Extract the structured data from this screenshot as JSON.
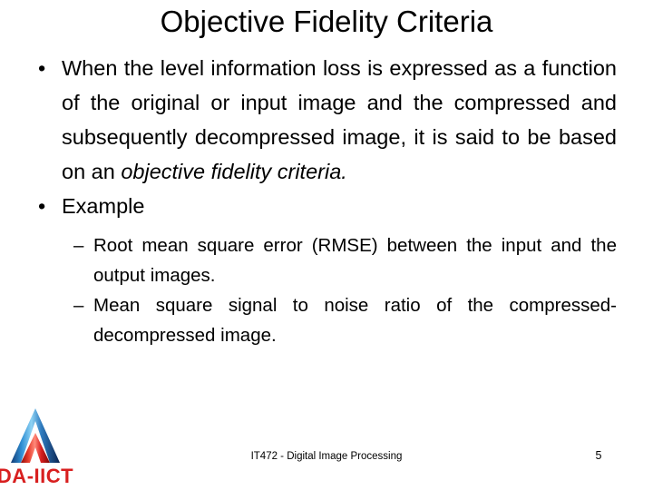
{
  "slide": {
    "title": "Objective Fidelity Criteria",
    "background_color": "#ffffff",
    "text_color": "#000000"
  },
  "content": {
    "bullet_marker": "•",
    "sub_bullet_marker": "–",
    "bullets": [
      {
        "level": 1,
        "text_plain": "When the level information loss is expressed as a function of the original or input image and the compressed and subsequently decompressed image, it is said to be based on an objective fidelity criteria.",
        "text_before_italic": "When the level information loss is expressed as a function of the original or input image and the compressed and subsequently decompressed image, it is said to be based on an ",
        "italic_text": "objective fidelity criteria."
      },
      {
        "level": 1,
        "text_plain": "Example"
      }
    ],
    "sub_bullets": [
      {
        "level": 2,
        "text_plain": "Root mean square error (RMSE) between the input and the output images."
      },
      {
        "level": 2,
        "text_plain": "Mean square signal to noise ratio of the compressed-decompressed image."
      }
    ]
  },
  "footer": {
    "course": "IT472 - Digital Image Processing",
    "page_number": "5"
  },
  "logo": {
    "text": "DA-IICT",
    "outer_color": "#1f6fbf",
    "outer_color_light": "#6fc3ef",
    "outer_color_dark": "#0d2f63",
    "inner_color": "#e02020",
    "inner_color_dark": "#9b0b0b",
    "text_color": "#d81f1f"
  }
}
